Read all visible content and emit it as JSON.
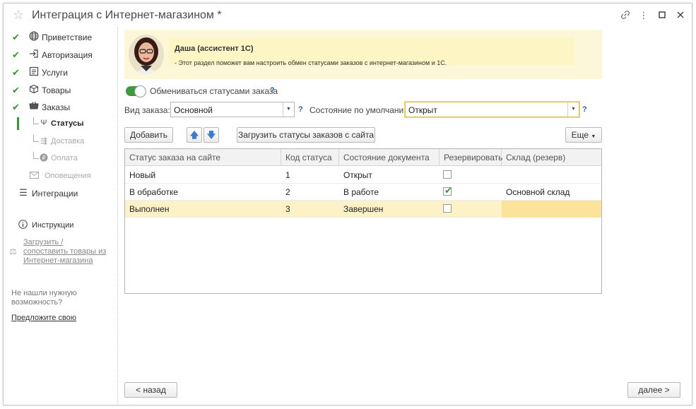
{
  "window": {
    "title": "Интеграция с Интернет-магазином *"
  },
  "sidebar": {
    "items": [
      {
        "label": "Приветствие"
      },
      {
        "label": "Авторизация"
      },
      {
        "label": "Услуги"
      },
      {
        "label": "Товары"
      },
      {
        "label": "Заказы"
      }
    ],
    "sub_items": [
      {
        "label": "Статусы"
      },
      {
        "label": "Доставка"
      },
      {
        "label": "Оплата"
      }
    ],
    "notifications_label": "Оповещения",
    "integrations_label": "Интеграции",
    "instructions_label": "Инструкции",
    "load_link": {
      "line1": "Загрузить /",
      "line2": "сопоставить товары из",
      "line3": "Интернет-магазина"
    },
    "note": {
      "line1": "Не нашли нужную",
      "line2": "возможность?"
    },
    "suggest_link": "Предложите свою"
  },
  "assistant": {
    "name": "Даша (ассистент 1С)",
    "text": "- Этот раздел поможет вам настроить обмен статусами заказов с интернет-магазином и 1С."
  },
  "form": {
    "exchange_toggle_label": "Обмениваться статусами заказа",
    "exchange_enabled": true,
    "help_mark": "?",
    "order_type_label": "Вид заказа:",
    "order_type_value": "Основной",
    "default_state_label": "Состояние по умолчанию:",
    "default_state_value": "Открыт"
  },
  "toolbar": {
    "add_label": "Добавить",
    "load_statuses_label": "Загрузить статусы заказов с сайта",
    "more_label": "Еще"
  },
  "table": {
    "columns": [
      "Статус заказа на сайте",
      "Код статуса",
      "Состояние документа",
      "Резервировать",
      "Склад (резерв)"
    ],
    "rows": [
      {
        "status": "Новый",
        "code": "1",
        "state": "Открыт",
        "reserve": false,
        "warehouse": ""
      },
      {
        "status": "В обработке",
        "code": "2",
        "state": "В работе",
        "reserve": true,
        "warehouse": "Основной склад"
      },
      {
        "status": "Выполнен",
        "code": "3",
        "state": "Завершен",
        "reserve": false,
        "warehouse": ""
      }
    ]
  },
  "footer": {
    "back_label": "< назад",
    "next_label": "далее >"
  },
  "colors": {
    "accent_green": "#2e9a2e",
    "assistant_bg": "#fcf7d8",
    "selected_row": "#fcf1c7",
    "focus_border": "#e0c040"
  }
}
